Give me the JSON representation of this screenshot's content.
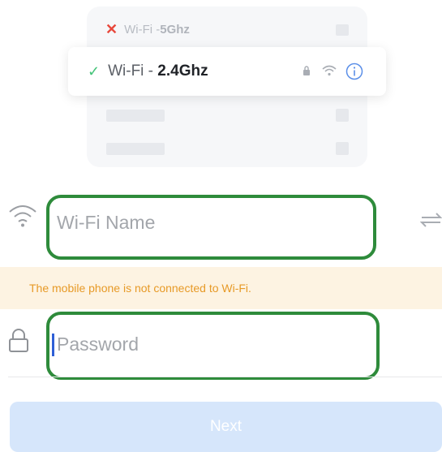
{
  "illustration": {
    "unavailable_network": {
      "prefix": "Wi-Fi - ",
      "band": "5Ghz"
    },
    "selected_network": {
      "prefix": "Wi-Fi - ",
      "band": "2.4Ghz"
    }
  },
  "form": {
    "wifi_name": {
      "value": "",
      "placeholder": "Wi-Fi Name"
    },
    "warning": "The mobile phone is not connected to Wi-Fi.",
    "password": {
      "value": "",
      "placeholder": "Password"
    }
  },
  "next_button": {
    "label": "Next"
  },
  "colors": {
    "highlight_border": "#2e8b3b",
    "warning_text": "#e79a27",
    "warning_bg": "#fdf3e2",
    "button_bg": "#d6e6fb",
    "check": "#46c47a",
    "cross": "#e8483c",
    "info": "#5b8fe8"
  },
  "icons": [
    "x-icon",
    "checkmark-icon",
    "lock-icon",
    "wifi-icon",
    "info-icon",
    "switch-arrows-icon"
  ]
}
